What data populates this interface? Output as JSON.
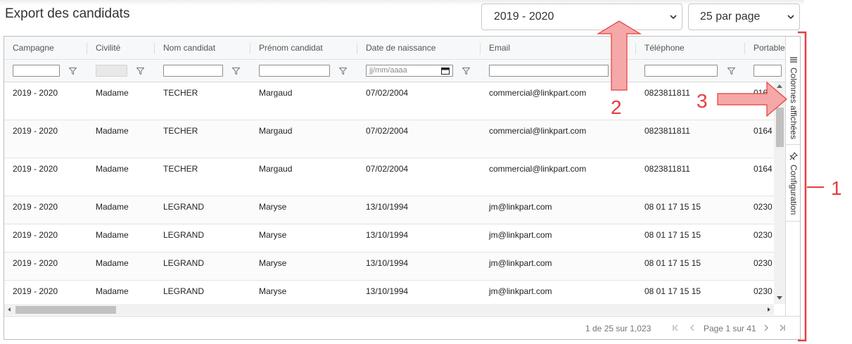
{
  "page": {
    "title": "Export des candidats"
  },
  "filters": {
    "campaign": "2019 - 2020",
    "per_page": "25 par page"
  },
  "table": {
    "columns": [
      "Campagne",
      "Civilité",
      "Nom candidat",
      "Prénom candidat",
      "Date de naissance",
      "Email",
      "Téléphone",
      "Portable"
    ],
    "date_placeholder": "jj/mm/aaaa",
    "rows": [
      [
        "2019 - 2020",
        "Madame",
        "TECHER",
        "Margaud",
        "07/02/2004",
        "commercial@linkpart.com",
        "0823811811",
        "0164"
      ],
      [
        "2019 - 2020",
        "Madame",
        "TECHER",
        "Margaud",
        "07/02/2004",
        "commercial@linkpart.com",
        "0823811811",
        "0164"
      ],
      [
        "2019 - 2020",
        "Madame",
        "TECHER",
        "Margaud",
        "07/02/2004",
        "commercial@linkpart.com",
        "0823811811",
        "0164"
      ],
      [
        "2019 - 2020",
        "Madame",
        "LEGRAND",
        "Maryse",
        "13/10/1994",
        "jm@linkpart.com",
        "08 01 17 15 15",
        "0230"
      ],
      [
        "2019 - 2020",
        "Madame",
        "LEGRAND",
        "Maryse",
        "13/10/1994",
        "jm@linkpart.com",
        "08 01 17 15 15",
        "0230"
      ],
      [
        "2019 - 2020",
        "Madame",
        "LEGRAND",
        "Maryse",
        "13/10/1994",
        "jm@linkpart.com",
        "08 01 17 15 15",
        "0230"
      ],
      [
        "2019 - 2020",
        "Madame",
        "LEGRAND",
        "Maryse",
        "13/10/1994",
        "jm@linkpart.com",
        "08 01 17 15 15",
        "0230"
      ]
    ]
  },
  "side_panel": {
    "columns_label": "Colonnes affichées",
    "config_label": "Configuration"
  },
  "pagination": {
    "summary": "1 de 25 sur 1,023",
    "page_label": "Page 1 sur 41"
  },
  "annotations": {
    "one": "1",
    "two": "2",
    "three": "3"
  },
  "colors": {
    "annotation": "#e53e3e",
    "annotation_fill": "#f6a7a7"
  }
}
